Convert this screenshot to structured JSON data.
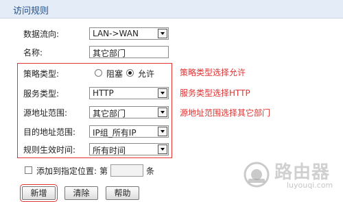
{
  "panel": {
    "title": "访问规则"
  },
  "form": {
    "direction": {
      "label": "数据流向:",
      "value": "LAN->WAN"
    },
    "name": {
      "label": "名称:",
      "value": "其它部门"
    },
    "policy": {
      "label": "策略类型:",
      "options": [
        "阻塞",
        "允许"
      ],
      "selected": "允许"
    },
    "service": {
      "label": "服务类型:",
      "value": "HTTP"
    },
    "src": {
      "label": "源地址范围:",
      "value": "其它部门"
    },
    "dst": {
      "label": "目的地址范围:",
      "value": "IP组_所有IP"
    },
    "time": {
      "label": "规则生效时间:",
      "value": "所有时间"
    },
    "position": {
      "checkbox_label": "添加到指定位置:",
      "prefix": "第",
      "suffix": "条",
      "value": ""
    }
  },
  "annotations": {
    "policy": "策略类型选择允许",
    "service": "服务类型选择HTTP",
    "src": "源地址范围选择其它部门"
  },
  "buttons": {
    "add": "新增",
    "clear": "清除",
    "help": "帮助"
  },
  "watermark": {
    "text": "路由器",
    "url": "luyouqi.com"
  },
  "colors": {
    "annotation": "#e23232",
    "header_bg": "#e3ecf7",
    "title": "#1f4e8c"
  }
}
